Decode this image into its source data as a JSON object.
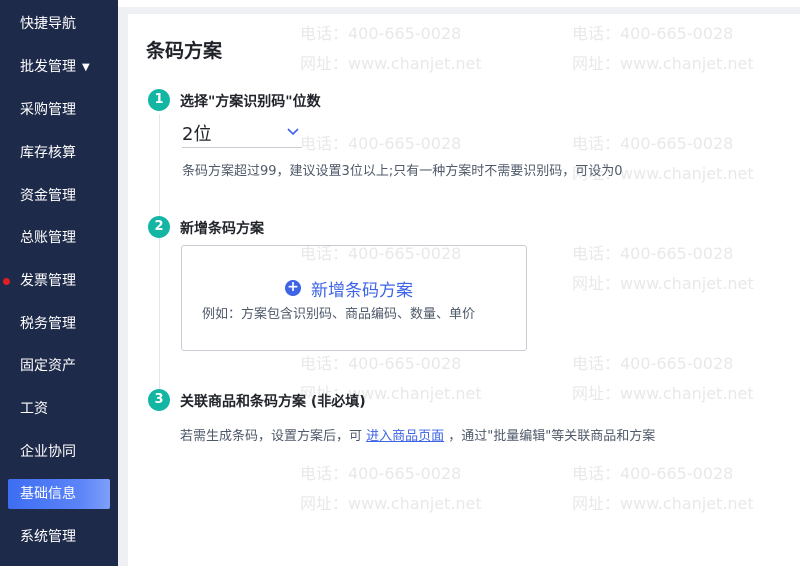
{
  "sidebar": {
    "items": [
      {
        "label": "快捷导航"
      },
      {
        "label": "批发管理"
      },
      {
        "label": "采购管理"
      },
      {
        "label": "库存核算"
      },
      {
        "label": "资金管理"
      },
      {
        "label": "总账管理"
      },
      {
        "label": "发票管理"
      },
      {
        "label": "税务管理"
      },
      {
        "label": "固定资产"
      },
      {
        "label": "工资"
      },
      {
        "label": "企业协同"
      },
      {
        "label": "基础信息"
      },
      {
        "label": "系统管理"
      }
    ],
    "active": "基础信息",
    "bg_color": "#1e2a4a",
    "active_color": "#3d6df2",
    "dot_color": "#e02020"
  },
  "page": {
    "title": "条码方案"
  },
  "steps": [
    {
      "number": "1",
      "title": "选择\"方案识别码\"位数",
      "select_value": "2位",
      "hint": "条码方案超过99，建议设置3位以上;只有一种方案时不需要识别码，可设为0"
    },
    {
      "number": "2",
      "title": "新增条码方案",
      "add_label": "新增条码方案",
      "example": "例如：方案包含识别码、商品编码、数量、单价"
    },
    {
      "number": "3",
      "title": "关联商品和条码方案 (非必填)",
      "desc_before": "若需生成条码，设置方案后，可 ",
      "link_text": "进入商品页面",
      "desc_after": " ，通过\"批量编辑\"等关联商品和方案"
    }
  ],
  "watermark": {
    "phone": "电话：400-665-0028",
    "site": "网址：www.chanjet.net"
  },
  "colors": {
    "accent": "#3d63e6",
    "step_badge": "#13b5a3"
  }
}
